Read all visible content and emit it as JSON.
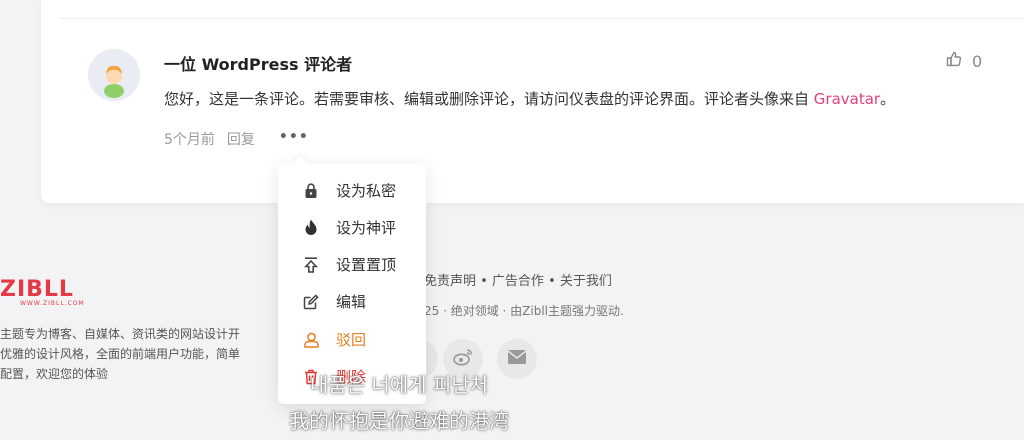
{
  "comment": {
    "author": "一位 WordPress 评论者",
    "likes": "0",
    "text": "您好，这是一条评论。若需要审核、编辑或删除评论，请访问仪表盘的评论界面。评论者头像来自 ",
    "link": "Gravatar",
    "text_end": "。",
    "time": "5个月前",
    "reply": "回复",
    "more": "•••"
  },
  "menu": {
    "items": [
      {
        "label": "设为私密",
        "icon": "lock-icon"
      },
      {
        "label": "设为神评",
        "icon": "fire-icon"
      },
      {
        "label": "设置置顶",
        "icon": "pin-top-icon"
      },
      {
        "label": "编辑",
        "icon": "edit-icon"
      },
      {
        "label": "驳回",
        "icon": "user-reject-icon"
      },
      {
        "label": "删除",
        "icon": "trash-icon"
      }
    ],
    "colors": {
      "warn": "#e67e22",
      "danger": "#e53935"
    }
  },
  "footer": {
    "logo": "ZIBLL",
    "logo_sub": "WWW.ZIBLL.COM",
    "desc": [
      "主题专为博客、自媒体、资讯类的网站设计开",
      "优雅的设计风格，全面的前端用户功能，简单",
      "配置，欢迎您的体验"
    ],
    "links": "免责声明  •  广告合作  •  关于我们",
    "copyright": "25 · 绝对领域 · 由Zibll主题强力驱动."
  },
  "subtitles": {
    "korean": "내품은 너에게 피난처",
    "chinese": "我的怀抱是你避难的港湾"
  }
}
